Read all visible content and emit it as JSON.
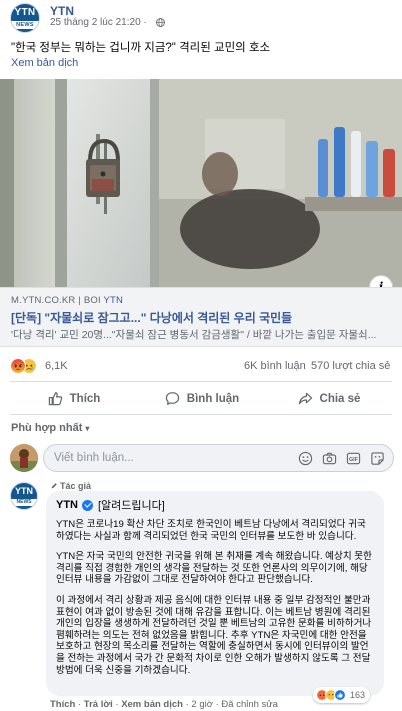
{
  "post": {
    "page_name": "YTN",
    "timestamp": "25 tháng 2 lúc 21:20 · ",
    "avatar_text": "YTN",
    "avatar_sub": "NEWS",
    "text": "\"한국 정부는 뭐하는 겁니까 지금?\" 격리된 교민의 호소",
    "translate": "Xem bản dịch"
  },
  "link": {
    "domain": "M.YTN.CO.KR",
    "separator": " | BOI ",
    "source": "YTN",
    "title": "[단독] \"자물쇠로 잠그고...\" 다낭에서 격리된 우리 국민들",
    "description": "'다낭 격리' 교민 20명...\"자물쇠 잠근 병동서 감금생활\" / 바깥 나가는 출입문 자물쇠...",
    "info_label": "i"
  },
  "stats": {
    "reaction_count": "6,1K",
    "comments": "6K bình luận",
    "shares": "570 lượt chia sẻ"
  },
  "actions": {
    "like": "Thích",
    "comment": "Bình luận",
    "share": "Chia sẻ"
  },
  "comments_section": {
    "sort_label": "Phù hợp nhất",
    "placeholder": "Viết bình luận..."
  },
  "reply": {
    "author_tag": "Tác giả",
    "name": "YTN",
    "header": "[알려드립니다]",
    "paragraphs": [
      "YTN은 코로나19 확산 차단 조치로 한국인이 베트남 다낭에서 격리되었다 귀국하였다는 사실과 함께 격리되었던 한국 국민의 인터뷰를 보도한 바 있습니다.",
      "YTN은 자국 국민의 안전한 귀국을 위해 본 취재를 계속 해왔습니다. 예상치 못한 격리를 직접 경험한 개인의 생각을 전달하는 것 또한 언론사의 의무이기에, 해당 인터뷰 내용을 가감없이 그대로 전달하여야 한다고 판단했습니다.",
      "이 과정에서 격리 상황과 제공 음식에 대한 인터뷰 내용 중 일부 감정적인 불만과 표현이 여과 없이 방송된 것에 대해 유감을 표합니다. 이는 베트남 병원에 격리된 개인의 입장을 생생하게 전달하려던 것일 뿐 베트남의 고유한 문화를 비하하거나 폄훼하려는 의도는 전혀 없었음을 밝힙니다. 추후 YTN은 자국민에 대한 안전을 보호하고 현장의 목소리를 전달하는 역할에 충실하면서 동시에 인터뷰이의 발언을 전하는 과정에서 국가 간 문화적 차이로 인한 오해가 발생하지 않도록 그 전달 방법에 더욱 신중을 기하겠습니다."
    ],
    "reaction_count": "163",
    "like": "Thích",
    "reply": "Trả lời",
    "translate": "Xem bản dịch",
    "time": "2 giờ",
    "edited": "Đã chỉnh sửa"
  },
  "colors": {
    "facebook_link": "#385898",
    "ytn_blue": "#14568f",
    "muted_text": "#65676b",
    "angry": "#f0613b",
    "sad": "#f7b125",
    "like": "#1877f2"
  },
  "icons": [
    "globe-icon",
    "info-icon",
    "angry-reaction-icon",
    "sad-reaction-icon",
    "like-reaction-icon",
    "thumbs-up-icon",
    "comment-icon",
    "share-icon",
    "emoji-icon",
    "camera-icon",
    "gif-icon",
    "sticker-icon",
    "verified-icon"
  ]
}
